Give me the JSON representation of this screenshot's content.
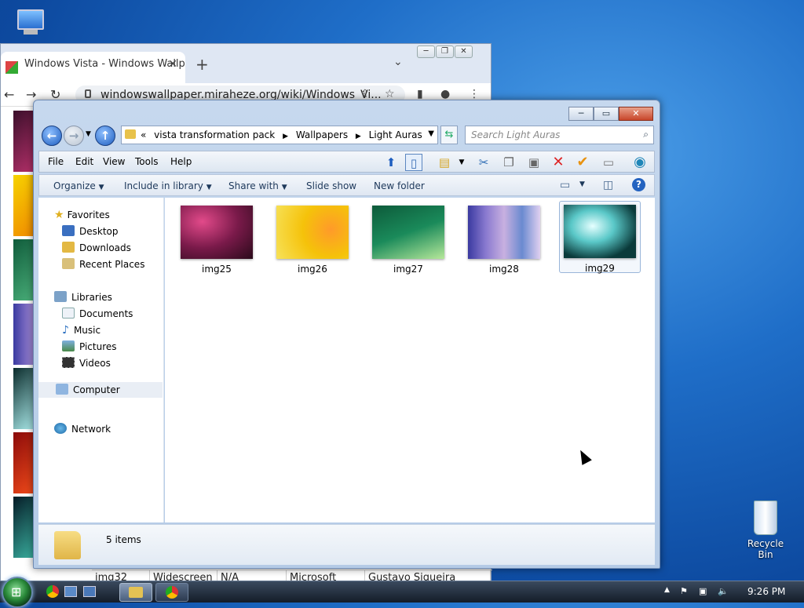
{
  "desktop": {
    "recycle_bin_label": "Recycle Bin"
  },
  "browser": {
    "tab_title": "Windows Vista - Windows Wallp",
    "tab_close": "✕",
    "new_tab": "+",
    "tab_list": "⌄",
    "url": "windowswallpaper.miraheze.org/wiki/Windows_Vi...",
    "table_row": [
      "img32",
      "Widescreen",
      "N/A",
      "Microsoft",
      "Gustavo Siqueira"
    ]
  },
  "explorer": {
    "breadcrumb": [
      "«",
      "vista transformation pack",
      "Wallpapers",
      "Light Auras"
    ],
    "search_placeholder": "Search Light Auras",
    "menu": {
      "file": "File",
      "edit": "Edit",
      "view": "View",
      "tools": "Tools",
      "help": "Help"
    },
    "commands": {
      "organize": "Organize",
      "include": "Include in library",
      "share": "Share with",
      "slideshow": "Slide show",
      "newfolder": "New folder"
    },
    "nav": {
      "favorites": "Favorites",
      "desktop": "Desktop",
      "downloads": "Downloads",
      "recent": "Recent Places",
      "libraries": "Libraries",
      "documents": "Documents",
      "music": "Music",
      "pictures": "Pictures",
      "videos": "Videos",
      "computer": "Computer",
      "network": "Network"
    },
    "files": [
      {
        "name": "img25"
      },
      {
        "name": "img26"
      },
      {
        "name": "img27"
      },
      {
        "name": "img28"
      },
      {
        "name": "img29"
      }
    ],
    "status": "5 items"
  },
  "taskbar": {
    "clock": "9:26 PM"
  }
}
